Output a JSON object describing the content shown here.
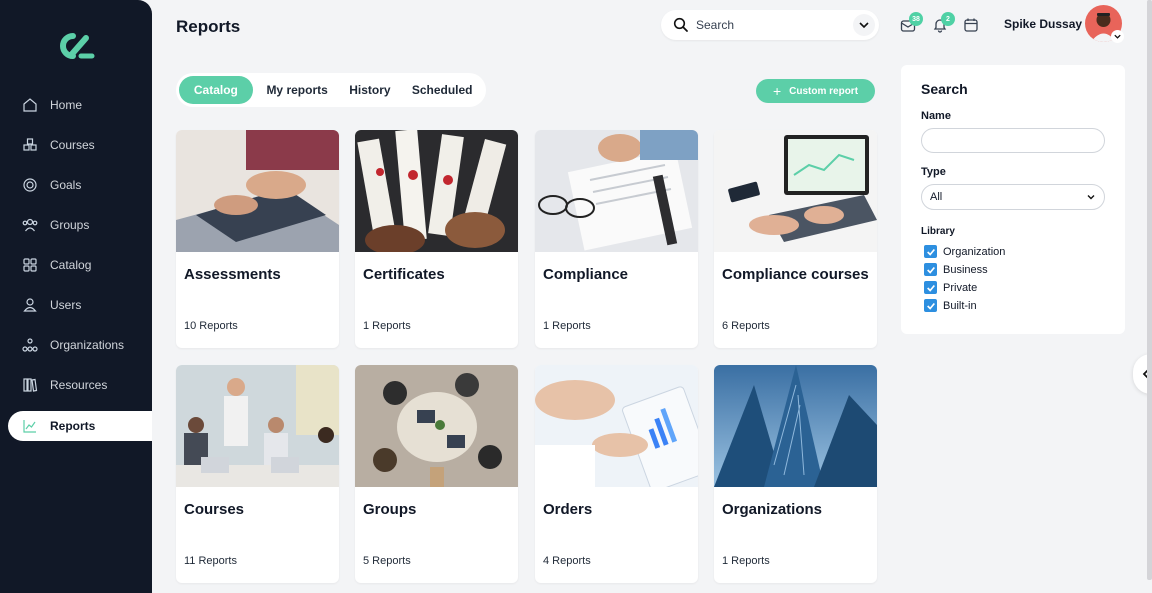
{
  "header": {
    "title": "Reports",
    "search_placeholder": "Search",
    "messages_badge": "38",
    "notifications_badge": "2",
    "user_name": "Spike Dussay"
  },
  "sidebar": {
    "items": [
      {
        "label": "Home",
        "icon": "home-icon"
      },
      {
        "label": "Courses",
        "icon": "courses-icon"
      },
      {
        "label": "Goals",
        "icon": "goals-icon"
      },
      {
        "label": "Groups",
        "icon": "groups-icon"
      },
      {
        "label": "Catalog",
        "icon": "catalog-icon"
      },
      {
        "label": "Users",
        "icon": "users-icon"
      },
      {
        "label": "Organizations",
        "icon": "organizations-icon"
      },
      {
        "label": "Resources",
        "icon": "resources-icon"
      },
      {
        "label": "Reports",
        "icon": "reports-icon",
        "active": true
      }
    ]
  },
  "tabs": [
    {
      "label": "Catalog",
      "active": true
    },
    {
      "label": "My reports"
    },
    {
      "label": "History"
    },
    {
      "label": "Scheduled"
    }
  ],
  "custom_report_label": "Custom report",
  "cards": [
    {
      "title": "Assessments",
      "count": "10 Reports"
    },
    {
      "title": "Certificates",
      "count": "1 Reports"
    },
    {
      "title": "Compliance",
      "count": "1 Reports"
    },
    {
      "title": "Compliance courses",
      "count": "6 Reports"
    },
    {
      "title": "Courses",
      "count": "11 Reports"
    },
    {
      "title": "Groups",
      "count": "5 Reports"
    },
    {
      "title": "Orders",
      "count": "4 Reports"
    },
    {
      "title": "Organizations",
      "count": "1 Reports"
    }
  ],
  "filter": {
    "title": "Search",
    "name_label": "Name",
    "name_value": "",
    "type_label": "Type",
    "type_value": "All",
    "library_label": "Library",
    "library_options": [
      {
        "label": "Organization",
        "checked": true
      },
      {
        "label": "Business",
        "checked": true
      },
      {
        "label": "Private",
        "checked": true
      },
      {
        "label": "Built-in",
        "checked": true
      }
    ]
  },
  "colors": {
    "accent": "#5ccfa8",
    "sidebar_bg": "#111827",
    "checkbox": "#2d8fe0"
  }
}
